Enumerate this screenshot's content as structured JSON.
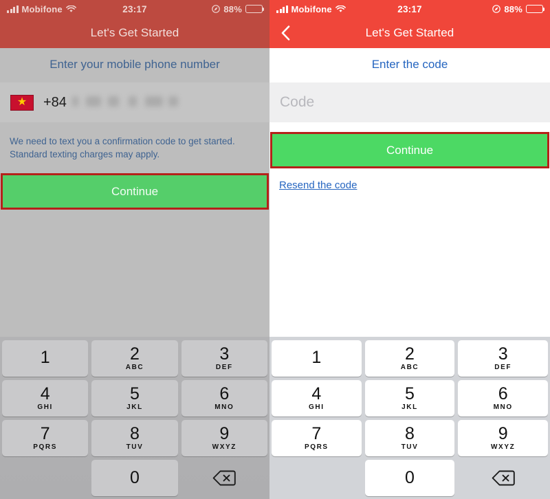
{
  "screens": [
    {
      "id": "phone-entry",
      "statusbar": {
        "carrier": "Mobifone",
        "time": "23:17",
        "battery_percent": "88%",
        "signal_icon": "signal-bars-icon",
        "wifi_icon": "wifi-icon",
        "location_icon": "location-arrow-icon",
        "battery_icon": "battery-icon"
      },
      "navbar": {
        "title": "Let's Get Started",
        "has_back": false,
        "back_icon": "chevron-left-icon"
      },
      "heading": "Enter your mobile phone number",
      "phone_field": {
        "flag_icon": "vietnam-flag-icon",
        "star_glyph": "★",
        "country_code": "+84",
        "number_value": "",
        "number_masked": true
      },
      "hint": "We need to text you a confirmation code to get started. Standard texting charges may apply.",
      "continue_label": "Continue",
      "annotation_color": "#b5211a"
    },
    {
      "id": "code-entry",
      "statusbar": {
        "carrier": "Mobifone",
        "time": "23:17",
        "battery_percent": "88%",
        "signal_icon": "signal-bars-icon",
        "wifi_icon": "wifi-icon",
        "location_icon": "location-arrow-icon",
        "battery_icon": "battery-icon"
      },
      "navbar": {
        "title": "Let's Get Started",
        "has_back": true,
        "back_icon": "chevron-left-icon"
      },
      "heading": "Enter the code",
      "code_field": {
        "value": "",
        "placeholder": "Code"
      },
      "continue_label": "Continue",
      "resend_label": "Resend the code",
      "annotation_color": "#b5211a"
    }
  ],
  "keypad": {
    "keys": [
      {
        "num": "1",
        "sub": ""
      },
      {
        "num": "2",
        "sub": "ABC"
      },
      {
        "num": "3",
        "sub": "DEF"
      },
      {
        "num": "4",
        "sub": "GHI"
      },
      {
        "num": "5",
        "sub": "JKL"
      },
      {
        "num": "6",
        "sub": "MNO"
      },
      {
        "num": "7",
        "sub": "PQRS"
      },
      {
        "num": "8",
        "sub": "TUV"
      },
      {
        "num": "9",
        "sub": "WXYZ"
      },
      {
        "num": "0",
        "sub": ""
      }
    ],
    "delete_icon": "backspace-delete-icon"
  },
  "colors": {
    "header_red": "#f0463a",
    "header_red_dim": "#bd4a40",
    "continue_green": "#4cd964",
    "link_blue": "#2565c0",
    "annotation_red": "#b5211a",
    "flag_red": "#c8102e",
    "flag_star_yellow": "#ffcd00"
  }
}
